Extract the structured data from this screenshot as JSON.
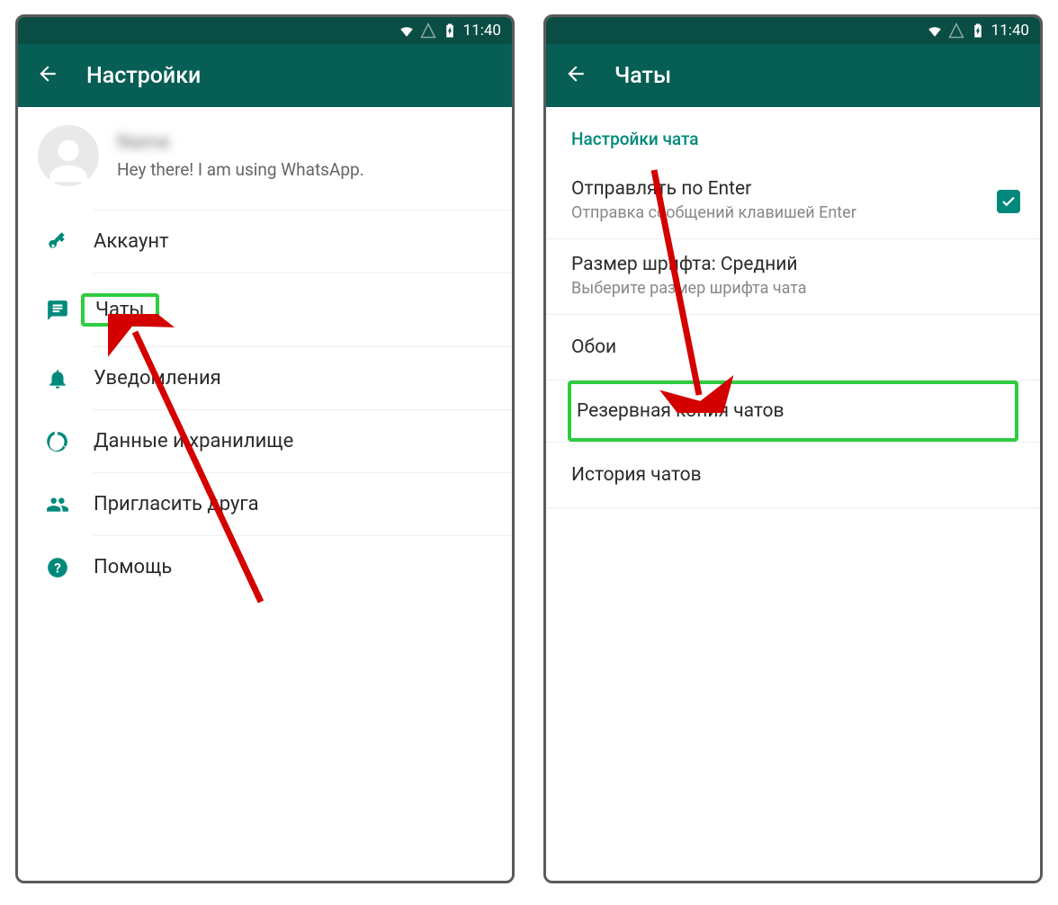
{
  "status": {
    "time": "11:40"
  },
  "screen1": {
    "title": "Настройки",
    "profile": {
      "name_blurred": "Name",
      "status": "Hey there! I am using WhatsApp."
    },
    "menu": {
      "account": "Аккаунт",
      "chats": "Чаты",
      "notifications": "Уведомления",
      "data": "Данные и хранилище",
      "invite": "Пригласить друга",
      "help": "Помощь"
    }
  },
  "screen2": {
    "title": "Чаты",
    "section": "Настройки чата",
    "rows": {
      "enter_send": {
        "primary": "Отправлять по Enter",
        "secondary": "Отправка сообщений клавишей Enter",
        "checked": true
      },
      "font_size": {
        "primary": "Размер шрифта: Средний",
        "secondary": "Выберите размер шрифта чата"
      },
      "wallpaper": "Обои",
      "backup": "Резервная копия чатов",
      "history": "История чатов"
    }
  }
}
